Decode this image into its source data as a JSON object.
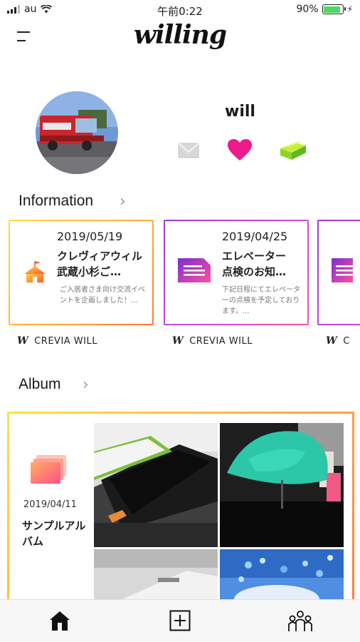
{
  "status_bar": {
    "carrier": "au",
    "time": "午前0:22",
    "battery_text": "90%",
    "battery_level": 0.9
  },
  "header": {
    "logo_text": "willing",
    "menu_icon": "hamburger-menu-icon"
  },
  "profile": {
    "username": "will",
    "icons": [
      "mail-icon",
      "heart-icon",
      "tag-icon"
    ],
    "accent_colors": {
      "heart": "#ec1a8a",
      "tag": "#8fd42c"
    }
  },
  "information": {
    "title": "Information",
    "cards": [
      {
        "date": "2019/05/19",
        "title": "クレヴィアウィル武蔵小杉ご…",
        "body": "ご入居者さま向け交流イベントを企画しました！...",
        "icon": "event-tent-icon",
        "source": "CREVIA WILL"
      },
      {
        "date": "2019/04/25",
        "title": "エレベーター点検のお知…",
        "body": "下記日程にてエレベーターの点検を予定しております。...",
        "icon": "document-icon",
        "source": "CREVIA WILL"
      },
      {
        "date": "",
        "title": "",
        "body": "",
        "icon": "document-icon",
        "source": "C"
      }
    ]
  },
  "album": {
    "title": "Album",
    "date": "2019/04/11",
    "name": "サンプルアルバム",
    "icon": "photo-stack-icon"
  },
  "tabbar": {
    "tabs": [
      "home-icon",
      "add-post-icon",
      "community-icon"
    ]
  }
}
